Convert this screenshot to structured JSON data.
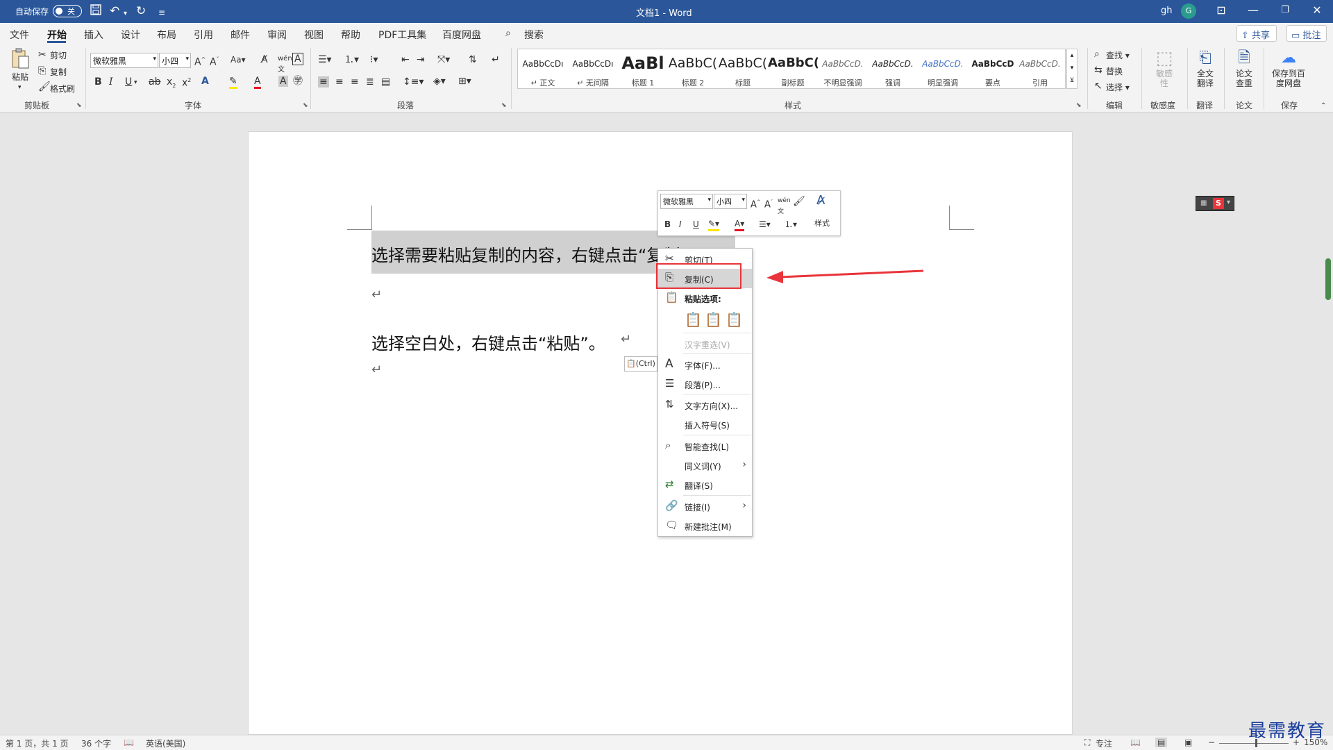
{
  "titlebar": {
    "autosave_label": "自动保存",
    "autosave_state": "关",
    "doc_title": "文档1  -  Word",
    "user_initials": "gh",
    "avatar_letter": "G",
    "save_icon": "save-icon",
    "undo_icon": "undo-icon",
    "redo_icon": "redo-icon"
  },
  "tabs": [
    "文件",
    "开始",
    "插入",
    "设计",
    "布局",
    "引用",
    "邮件",
    "审阅",
    "视图",
    "帮助",
    "PDF工具集",
    "百度网盘"
  ],
  "active_tab": "开始",
  "search_label": "搜索",
  "share_label": "共享",
  "comments_label": "批注",
  "ribbon": {
    "clipboard": {
      "paste": "粘贴",
      "cut": "剪切",
      "copy": "复制",
      "format_painter": "格式刷",
      "label": "剪贴板"
    },
    "font": {
      "font_name": "微软雅黑",
      "font_size": "小四",
      "change_case": "Aa",
      "label": "字体"
    },
    "paragraph": {
      "label": "段落"
    },
    "styles": {
      "label": "样式",
      "items": [
        {
          "preview": "AaBbCcDı",
          "name": "↵ 正文"
        },
        {
          "preview": "AaBbCcDı",
          "name": "↵ 无间隔"
        },
        {
          "preview": "AaBl",
          "name": "标题 1"
        },
        {
          "preview": "AaBbC(",
          "name": "标题 2"
        },
        {
          "preview": "AaBbC(",
          "name": "标题"
        },
        {
          "preview": "AaBbC(",
          "name": "副标题"
        },
        {
          "preview": "AaBbCcD.",
          "name": "不明显强调"
        },
        {
          "preview": "AaBbCcD.",
          "name": "强调"
        },
        {
          "preview": "AaBbCcD.",
          "name": "明显强调"
        },
        {
          "preview": "AaBbCcD",
          "name": "要点"
        },
        {
          "preview": "AaBbCcD.",
          "name": "引用"
        }
      ]
    },
    "editing": {
      "find": "查找",
      "replace": "替换",
      "select": "选择",
      "label": "编辑"
    },
    "sensitivity": {
      "button": "敏感性",
      "label": "敏感度"
    },
    "translate": {
      "button": "全文翻译",
      "label": "翻译"
    },
    "paper": {
      "button": "论文查重",
      "label": "论文"
    },
    "save": {
      "button": "保存到百度网盘",
      "label": "保存"
    }
  },
  "document": {
    "line1": "选择需要粘贴复制的内容，右键点击“复制”",
    "line2": "选择空白处，右键点击“粘贴”。",
    "paste_tag": "(Ctrl)"
  },
  "mini_toolbar": {
    "font_name": "微软雅黑",
    "font_size": "小四",
    "styles_label": "样式"
  },
  "context_menu": {
    "cut": "剪切(T)",
    "copy": "复制(C)",
    "paste_options": "粘贴选项:",
    "reconvert": "汉字重选(V)",
    "font": "字体(F)...",
    "paragraph": "段落(P)...",
    "text_direction": "文字方向(X)...",
    "insert_symbol": "插入符号(S)",
    "smart_lookup": "智能查找(L)",
    "synonyms": "同义词(Y)",
    "translate": "翻译(S)",
    "link": "链接(I)",
    "new_comment": "新建批注(M)"
  },
  "statusbar": {
    "page": "第 1 页，共 1 页",
    "words": "36 个字",
    "language": "英语(美国)",
    "focus": "专注",
    "zoom": "150%"
  },
  "watermark": "最需教育",
  "colors": {
    "accent": "#2b579a",
    "annotation_red": "#e8343a",
    "selection": "#d0d0d0"
  }
}
